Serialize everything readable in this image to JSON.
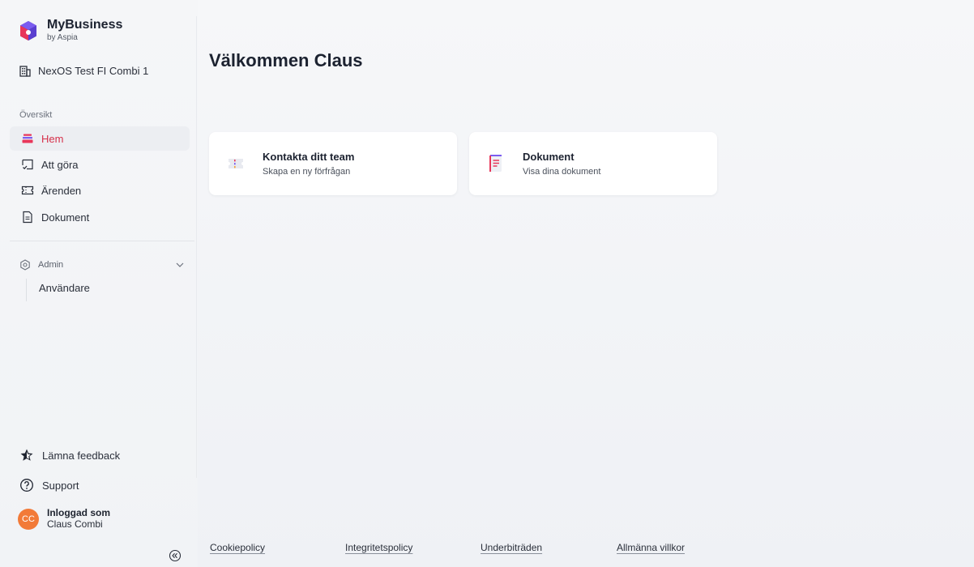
{
  "brand": {
    "name": "MyBusiness",
    "sub": "by Aspia"
  },
  "org": {
    "name": "NexOS Test FI Combi 1"
  },
  "sidebar": {
    "section_label": "Översikt",
    "items": [
      {
        "label": "Hem",
        "icon": "home-stack-icon",
        "active": true
      },
      {
        "label": "Att göra",
        "icon": "todo-check-icon"
      },
      {
        "label": "Ärenden",
        "icon": "ticket-icon"
      },
      {
        "label": "Dokument",
        "icon": "document-icon"
      }
    ],
    "admin": {
      "label": "Admin",
      "icon": "gear-icon",
      "sub_items": [
        {
          "label": "Användare"
        }
      ]
    },
    "feedback_label": "Lämna feedback",
    "support_label": "Support",
    "user": {
      "initials": "CC",
      "label": "Inloggad som",
      "name": "Claus Combi"
    }
  },
  "main": {
    "title": "Välkommen Claus",
    "cards": [
      {
        "title": "Kontakta ditt team",
        "subtitle": "Skapa en ny förfrågan",
        "icon": "ticket-icon"
      },
      {
        "title": "Dokument",
        "subtitle": "Visa dina dokument",
        "icon": "document-icon"
      }
    ]
  },
  "footer": {
    "links": [
      "Cookiepolicy",
      "Integritetspolicy",
      "Underbiträden",
      "Allmänna villkor"
    ]
  },
  "colors": {
    "accent": "#d6304a",
    "avatar": "#f27a38"
  }
}
